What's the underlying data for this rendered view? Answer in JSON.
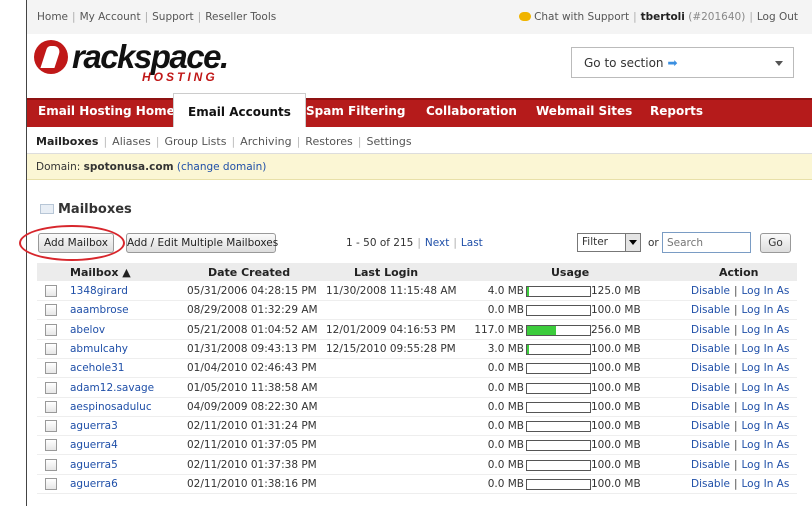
{
  "top_nav": {
    "links": [
      "Home",
      "My Account",
      "Support",
      "Reseller Tools"
    ],
    "chat": "Chat with Support",
    "user": "tbertoli",
    "account_id": "(#201640)",
    "logout": "Log Out"
  },
  "logo": {
    "name": "rackspace.",
    "sub": "HOSTING"
  },
  "goto": {
    "label": "Go to section"
  },
  "main_nav": {
    "tabs": [
      {
        "label": "Email Hosting Home",
        "active": false
      },
      {
        "label": "Email Accounts",
        "active": true
      },
      {
        "label": "Spam Filtering",
        "active": false
      },
      {
        "label": "Collaboration",
        "active": false
      },
      {
        "label": "Webmail Sites",
        "active": false
      },
      {
        "label": "Reports",
        "active": false
      }
    ]
  },
  "sub_nav": {
    "items": [
      "Mailboxes",
      "Aliases",
      "Group Lists",
      "Archiving",
      "Restores",
      "Settings"
    ]
  },
  "domain": {
    "label": "Domain:",
    "value": "spotonusa.com",
    "change": "(change domain)"
  },
  "page_title": "Mailboxes",
  "toolbar": {
    "add_mailbox": "Add Mailbox",
    "add_multiple": "Add / Edit Multiple Mailboxes",
    "range": "1 - 50 of 215",
    "next": "Next",
    "last": "Last",
    "filter_value": "Filter",
    "or": "or",
    "search_placeholder": "Search",
    "go": "Go"
  },
  "columns": {
    "mailbox": "Mailbox ▲",
    "date_created": "Date Created",
    "last_login": "Last Login",
    "usage": "Usage",
    "action": "Action"
  },
  "actions": {
    "disable": "Disable",
    "login": "Log In As"
  },
  "rows": [
    {
      "mailbox": "1348girard",
      "created": "05/31/2006 04:28:15 PM",
      "last_login": "11/30/2008 11:15:48 AM",
      "used": "4.0 MB",
      "total": "125.0 MB",
      "fraction": 0.032
    },
    {
      "mailbox": "aaambrose",
      "created": "08/29/2008 01:32:29 AM",
      "last_login": "",
      "used": "0.0 MB",
      "total": "100.0 MB",
      "fraction": 0
    },
    {
      "mailbox": "abelov",
      "created": "05/21/2008 01:04:52 AM",
      "last_login": "12/01/2009 04:16:53 PM",
      "used": "117.0 MB",
      "total": "256.0 MB",
      "fraction": 0.457
    },
    {
      "mailbox": "abmulcahy",
      "created": "01/31/2008 09:43:13 PM",
      "last_login": "12/15/2010 09:55:28 PM",
      "used": "3.0 MB",
      "total": "100.0 MB",
      "fraction": 0.03
    },
    {
      "mailbox": "acehole31",
      "created": "01/04/2010 02:46:43 PM",
      "last_login": "",
      "used": "0.0 MB",
      "total": "100.0 MB",
      "fraction": 0
    },
    {
      "mailbox": "adam12.savage",
      "created": "01/05/2010 11:38:58 AM",
      "last_login": "",
      "used": "0.0 MB",
      "total": "100.0 MB",
      "fraction": 0
    },
    {
      "mailbox": "aespinosaduluc",
      "created": "04/09/2009 08:22:30 AM",
      "last_login": "",
      "used": "0.0 MB",
      "total": "100.0 MB",
      "fraction": 0
    },
    {
      "mailbox": "aguerra3",
      "created": "02/11/2010 01:31:24 PM",
      "last_login": "",
      "used": "0.0 MB",
      "total": "100.0 MB",
      "fraction": 0
    },
    {
      "mailbox": "aguerra4",
      "created": "02/11/2010 01:37:05 PM",
      "last_login": "",
      "used": "0.0 MB",
      "total": "100.0 MB",
      "fraction": 0
    },
    {
      "mailbox": "aguerra5",
      "created": "02/11/2010 01:37:38 PM",
      "last_login": "",
      "used": "0.0 MB",
      "total": "100.0 MB",
      "fraction": 0
    },
    {
      "mailbox": "aguerra6",
      "created": "02/11/2010 01:38:16 PM",
      "last_login": "",
      "used": "0.0 MB",
      "total": "100.0 MB",
      "fraction": 0
    }
  ]
}
